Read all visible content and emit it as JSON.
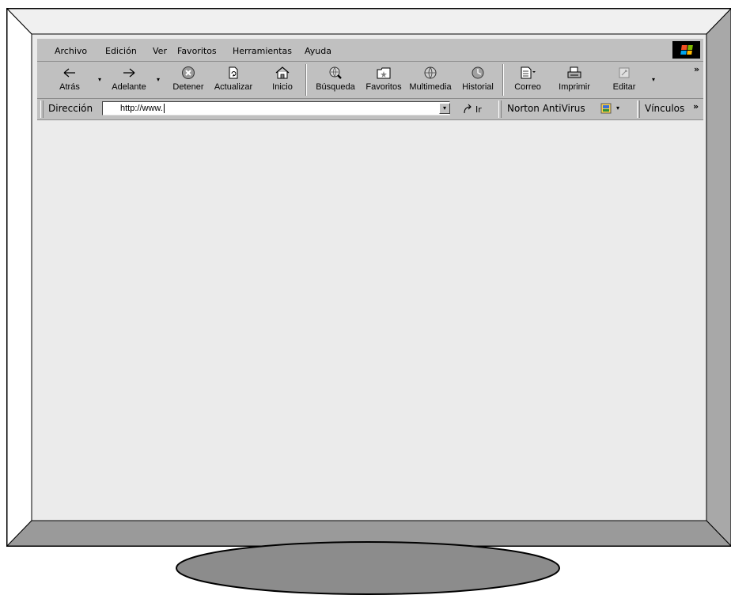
{
  "menu": {
    "items": [
      "Archivo",
      "Edición",
      "Ver",
      "Favoritos",
      "Herramientas",
      "Ayuda"
    ]
  },
  "toolbar": {
    "back": "Atrás",
    "forward": "Adelante",
    "stop": "Detener",
    "refresh": "Actualizar",
    "home": "Inicio",
    "search": "Búsqueda",
    "favorites": "Favoritos",
    "media": "Multimedia",
    "history": "Historial",
    "mail": "Correo",
    "print": "Imprimir",
    "edit": "Editar"
  },
  "address": {
    "label": "Dirección",
    "value": "http://www.",
    "go": "Ir"
  },
  "norton": {
    "label": "Norton AntiVirus"
  },
  "links": {
    "label": "Vínculos"
  },
  "icons": {
    "more": "»",
    "dropdown": "▾",
    "go": "go-arrow-icon"
  },
  "colors": {
    "viewport": "#ebebeb",
    "bezel": "#ececec",
    "chrome": "#c0c0c0",
    "stand": "#8c8c8c"
  }
}
